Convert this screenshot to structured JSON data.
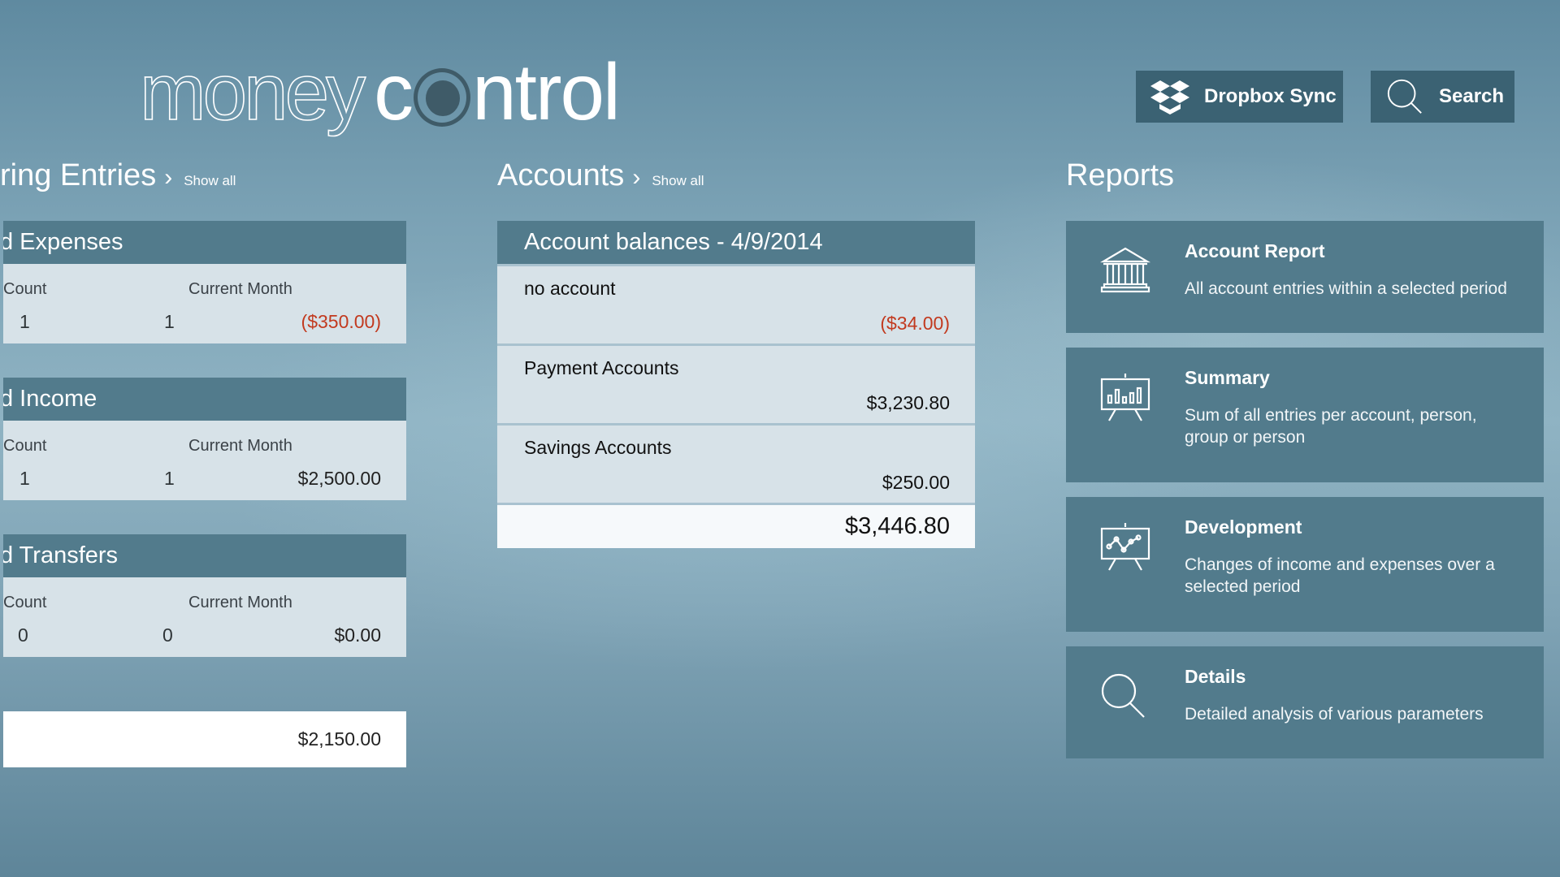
{
  "app": {
    "logo_part1": "money",
    "logo_part2_pre": "c",
    "logo_part2_post": "ntrol"
  },
  "toolbar": {
    "dropbox_label": "Dropbox Sync",
    "dropbox_icon": "dropbox-icon",
    "search_label": "Search",
    "search_icon": "search-icon"
  },
  "recurring": {
    "title": "ring Entries",
    "show_all": "Show all",
    "cards": [
      {
        "title": "d Expenses",
        "count_label": "Count",
        "month_label": "Current Month",
        "count": "1",
        "month_count": "1",
        "amount": "($350.00)",
        "negative": true
      },
      {
        "title": "d Income",
        "count_label": "Count",
        "month_label": "Current Month",
        "count": "1",
        "month_count": "1",
        "amount": "$2,500.00",
        "negative": false
      },
      {
        "title": "d Transfers",
        "count_label": "Count",
        "month_label": "Current Month",
        "count": "0",
        "month_count": "0",
        "amount": "$0.00",
        "negative": false
      }
    ],
    "total": "$2,150.00"
  },
  "accounts": {
    "title": "Accounts",
    "show_all": "Show all",
    "header": "Account balances - 4/9/2014",
    "rows": [
      {
        "name": "no account",
        "amount": "($34.00)",
        "negative": true
      },
      {
        "name": "Payment Accounts",
        "amount": "$3,230.80",
        "negative": false
      },
      {
        "name": "Savings Accounts",
        "amount": "$250.00",
        "negative": false
      }
    ],
    "total": "$3,446.80"
  },
  "reports": {
    "title": "Reports",
    "items": [
      {
        "title": "Account Report",
        "description": "All account entries within a selected period",
        "icon": "bank-icon"
      },
      {
        "title": "Summary",
        "description": "Sum of all entries per account, person, group or person",
        "icon": "bar-chart-board-icon"
      },
      {
        "title": "Development",
        "description": "Changes of income and expenses over a selected period",
        "icon": "line-chart-board-icon"
      },
      {
        "title": "Details",
        "description": "Detailed analysis of various parameters",
        "icon": "magnifier-icon"
      }
    ]
  },
  "colors": {
    "tile": "#527b8c",
    "button": "#3b6273",
    "negative": "#c23a1f",
    "row_bg": "#d7e2e8"
  }
}
